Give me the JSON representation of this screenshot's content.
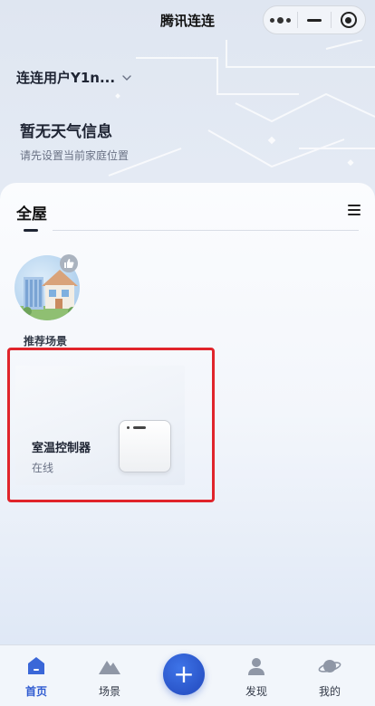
{
  "topbar": {
    "title": "腾讯连连"
  },
  "header": {
    "user_name": "连连用户Y1n...",
    "weather_title": "暂无天气信息",
    "weather_subtitle": "请先设置当前家庭位置"
  },
  "panel": {
    "tab_label": "全屋",
    "scene_label": "推荐场景",
    "device": {
      "name": "室温控制器",
      "status": "在线"
    }
  },
  "nav": {
    "items": [
      {
        "label": "首页",
        "icon": "home-icon",
        "active": true
      },
      {
        "label": "场景",
        "icon": "mountain-icon",
        "active": false
      },
      {
        "label": "+",
        "icon": "plus-icon",
        "active": false
      },
      {
        "label": "发现",
        "icon": "person-icon",
        "active": false
      },
      {
        "label": "我的",
        "icon": "planet-icon",
        "active": false
      }
    ]
  },
  "colors": {
    "accent": "#2f5bd1",
    "highlight": "#e0242b"
  }
}
